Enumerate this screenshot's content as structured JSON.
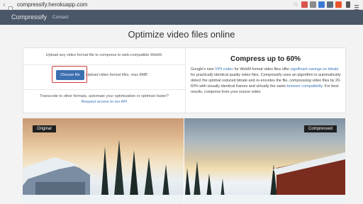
{
  "browser": {
    "url": "compressify.herokuapp.com",
    "back_icon": "back-arrow-icon",
    "lock_icon": "page-icon",
    "extensions": [
      "star-icon",
      "puzzle-icon",
      "translate-icon",
      "mail-icon",
      "shield-icon",
      "office-icon",
      "bookmark-icon",
      "menu-icon"
    ]
  },
  "nav": {
    "brand": "Compressify",
    "contact": "Contact"
  },
  "page": {
    "title": "Optimize video files online"
  },
  "left": {
    "upload_text": "Upload any video format file to compress to web-compatible WebM.",
    "choose_button": "Choose file",
    "choose_hint": "Upload video format files, max 8MB",
    "transcode_text": "Transcode to other formats, automate your optimization or optimize faster?",
    "request_link": "Request access to our API"
  },
  "right": {
    "title": "Compress up to 60%",
    "p1": "Google's new ",
    "link1": "VP9 codec",
    "p2": " for WebM format video files offer ",
    "link2": "significant savings on bitrate",
    "p3": " for practically identical quality video files. Compressify uses an algorithm to automatically detect the optimal reduced bitrate and re-encodes the file, compressing video files by 20-60% with visually identical frames and virtually the same ",
    "link3": "browser compatibility",
    "p4": ". For best results, compress from your source video"
  },
  "compare": {
    "original_label": "Original",
    "compressed_label": "Compressed"
  },
  "colors": {
    "nav_bg": "#4a5769",
    "button_bg": "#3b6fb0",
    "link": "#3b73b9",
    "highlight": "#d63b3b"
  }
}
